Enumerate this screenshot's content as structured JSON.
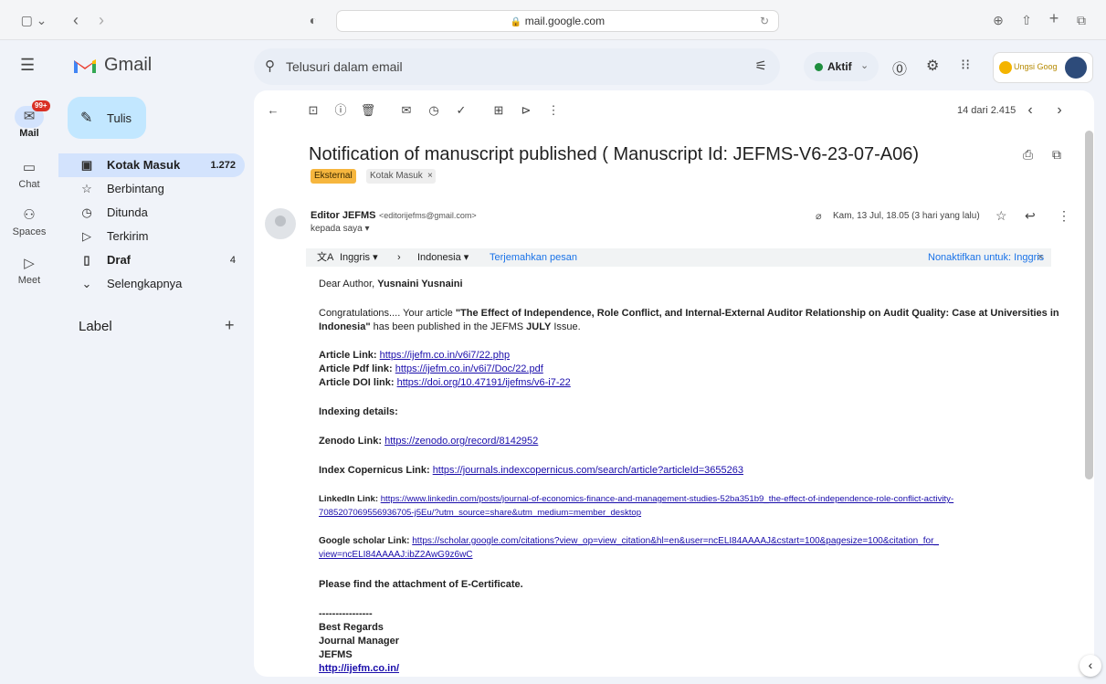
{
  "browser": {
    "url": "mail.google.com"
  },
  "app": {
    "name": "Gmail"
  },
  "rail": {
    "items": [
      {
        "label": "Mail",
        "badge": "99+"
      },
      {
        "label": "Chat"
      },
      {
        "label": "Spaces"
      },
      {
        "label": "Meet"
      }
    ]
  },
  "nav": {
    "compose": "Tulis",
    "items": [
      {
        "label": "Kotak Masuk",
        "count": "1.272"
      },
      {
        "label": "Berbintang",
        "count": ""
      },
      {
        "label": "Ditunda",
        "count": ""
      },
      {
        "label": "Terkirim",
        "count": ""
      },
      {
        "label": "Draf",
        "count": "4"
      },
      {
        "label": "Selengkapnya",
        "count": ""
      }
    ],
    "labels_title": "Label"
  },
  "header": {
    "search_placeholder": "Telusuri dalam email",
    "status": "Aktif",
    "brand_text": "Ungsi Google Apps"
  },
  "toolbar": {
    "pagination": "14 dari 2.415"
  },
  "email": {
    "subject": "Notification of manuscript published ( Manuscript Id: JEFMS-V6-23-07-A06)",
    "tags": [
      "Eksternal",
      "Kotak Masuk"
    ],
    "sender_name": "Editor JEFMS",
    "sender_email": "<editorijefms@gmail.com>",
    "to": "kepada saya",
    "date": "Kam, 13 Jul, 18.05 (3 hari yang lalu)",
    "translate": {
      "from": "Inggris",
      "to": "Indonesia",
      "action": "Terjemahkan pesan",
      "disable": "Nonaktifkan untuk: Inggris"
    },
    "greeting": "Dear Author,",
    "author": "Yusnaini Yusnaini",
    "congrats_1": "Congratulations.... Your article ",
    "article_title_1": "\"The Effect of Independence, Role Conflict, and Internal-External Auditor Relationship on Audit Quality: Case at Universities in",
    "article_title_2": "Indonesia\"",
    "congrats_2": " has been published in the JEFMS ",
    "issue": "JULY",
    "congrats_3": " Issue.",
    "links": [
      {
        "label": "Article Link: ",
        "url": "https://ijefm.co.in/v6i7/22.php"
      },
      {
        "label": "Article Pdf link:  ",
        "url": "https://ijefm.co.in/v6i7/Doc/22.pdf"
      },
      {
        "label": "Article DOI link: ",
        "url": "https://doi.org/10.47191/ijefms/v6-i7-22"
      }
    ],
    "indexing_title": "Indexing details:",
    "zenodo": {
      "label": "Zenodo Link: ",
      "url": "https://zenodo.org/record/8142952"
    },
    "copernicus": {
      "label": "Index Copernicus Link: ",
      "url": "https://journals.indexcopernicus.com/search/article?articleId=3655263"
    },
    "linkedin": {
      "label": "LinkedIn Link: ",
      "url_1": "https://www.linkedin.com/posts/journal-of-economics-finance-and-management-studies-52ba351b9_the-effect-of-independence-role-conflict-activity-",
      "url_2": "7085207069556936705-j5Eu/?utm_source=share&utm_medium=member_desktop"
    },
    "scholar": {
      "label": "Google scholar Link: ",
      "url_1": "https://scholar.google.com/citations?view_op=view_citation&hl=en&user=ncELI84AAAAJ&cstart=100&pagesize=100&citation_for_",
      "url_2": "view=ncELI84AAAAJ:ibZ2AwG9z6wC"
    },
    "attachment_note": "Please find the attachment of E-Certificate.",
    "divider": "----------------",
    "sign_1": "Best Regards",
    "sign_2": "Journal Manager",
    "sign_3": "JEFMS",
    "sign_4": "http://ijefm.co.in/"
  }
}
